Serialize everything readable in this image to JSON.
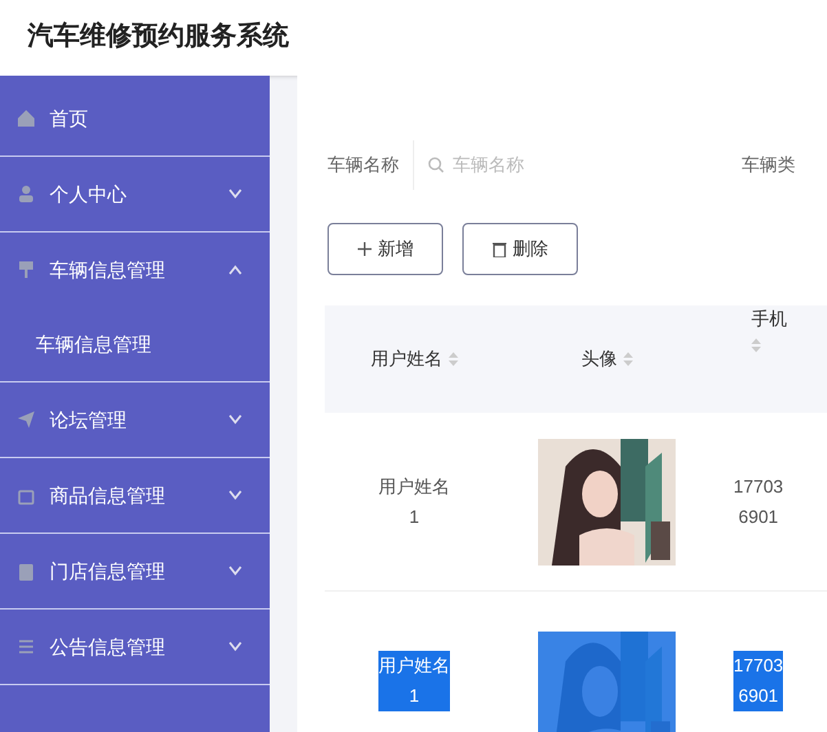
{
  "header": {
    "title": "汽车维修预约服务系统"
  },
  "sidebar": {
    "items": [
      {
        "label": "首页",
        "kind": "home"
      },
      {
        "label": "个人中心",
        "kind": "user",
        "expanded": false
      },
      {
        "label": "车辆信息管理",
        "kind": "car",
        "expanded": true,
        "children": [
          {
            "label": "车辆信息管理"
          }
        ]
      },
      {
        "label": "论坛管理",
        "kind": "plane",
        "expanded": false
      },
      {
        "label": "商品信息管理",
        "kind": "bag",
        "expanded": false
      },
      {
        "label": "门店信息管理",
        "kind": "clipboard",
        "expanded": false
      },
      {
        "label": "公告信息管理",
        "kind": "lines",
        "expanded": false
      }
    ]
  },
  "search": {
    "label": "车辆名称",
    "placeholder": "车辆名称",
    "next_label": "车辆类"
  },
  "buttons": [
    {
      "label": "新增",
      "kind": "add"
    },
    {
      "label": "删除",
      "kind": "delete"
    }
  ],
  "table": {
    "columns": [
      "用户姓名",
      "头像",
      "手机"
    ],
    "rows": [
      {
        "name": "用户姓名\n1",
        "phone": "17703\n6901",
        "highlighted": false
      },
      {
        "name": "用户姓名\n1",
        "phone": "17703\n6901",
        "highlighted": true
      }
    ]
  }
}
